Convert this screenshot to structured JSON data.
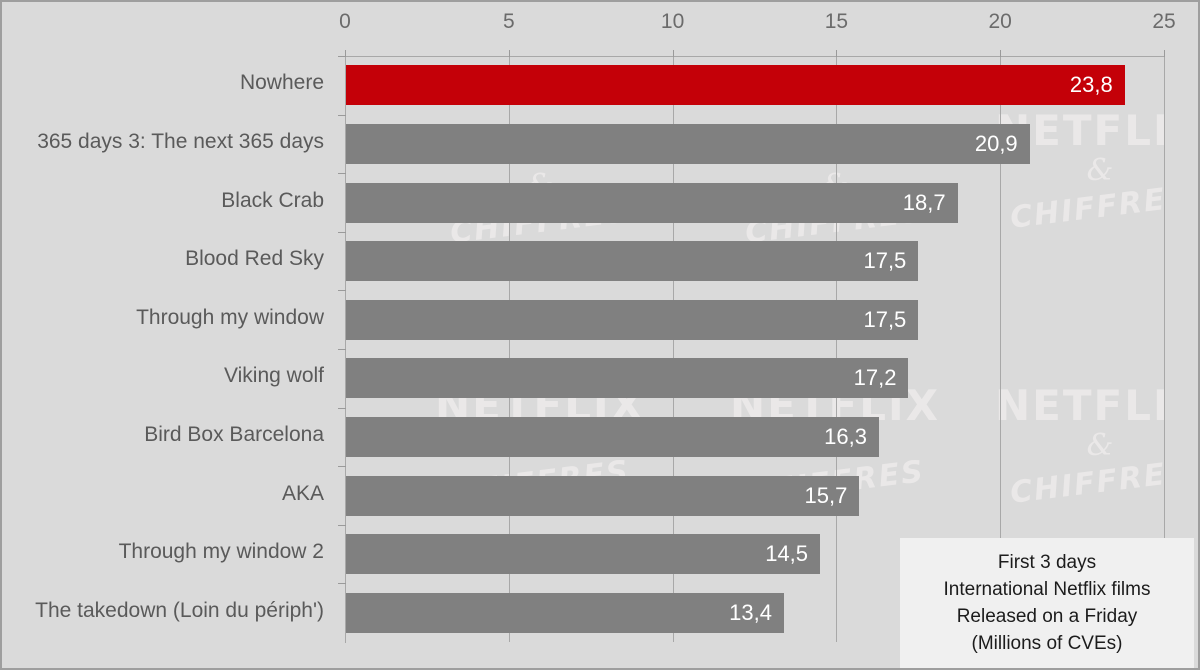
{
  "chart_data": {
    "type": "bar",
    "orientation": "horizontal",
    "title": "",
    "subtitle": "",
    "xlabel": "",
    "ylabel": "",
    "xlim": [
      0,
      25
    ],
    "xticks": [
      0,
      5,
      10,
      15,
      20,
      25
    ],
    "xtick_labels": [
      "0",
      "5",
      "10",
      "15",
      "20",
      "25"
    ],
    "grid": true,
    "legend": false,
    "decimal_separator": ",",
    "categories": [
      "Nowhere",
      "365 days 3: The next 365 days",
      "Black Crab",
      "Blood Red Sky",
      "Through my window",
      "Viking wolf",
      "Bird Box Barcelona",
      "AKA",
      "Through my window 2",
      "The takedown (Loin du périph')"
    ],
    "values": [
      23.8,
      20.9,
      18.7,
      17.5,
      17.5,
      17.2,
      16.3,
      15.7,
      14.5,
      13.4
    ],
    "value_labels": [
      "23,8",
      "20,9",
      "18,7",
      "17,5",
      "17,5",
      "17,2",
      "16,3",
      "15,7",
      "14,5",
      "13,4"
    ],
    "highlight_index": 0,
    "colors": {
      "highlight_bar": "#c40008",
      "bar": "#808080",
      "background": "#dadada",
      "value_label": "#ffffff",
      "category_label": "#5a5a5a",
      "tick_label": "#6b6b6b",
      "gridline": "#a8a8a8",
      "caption_background": "#f0f0f0",
      "caption_text": "#1c1c1c",
      "watermark": "#eceaea"
    }
  },
  "caption": {
    "lines": [
      "First 3 days",
      "International Netflix films",
      "Released on a Friday",
      "(Millions of CVEs)"
    ]
  },
  "watermark": {
    "line1": "NETFLIX",
    "line2": "&",
    "line3": "CHIFFRES"
  }
}
